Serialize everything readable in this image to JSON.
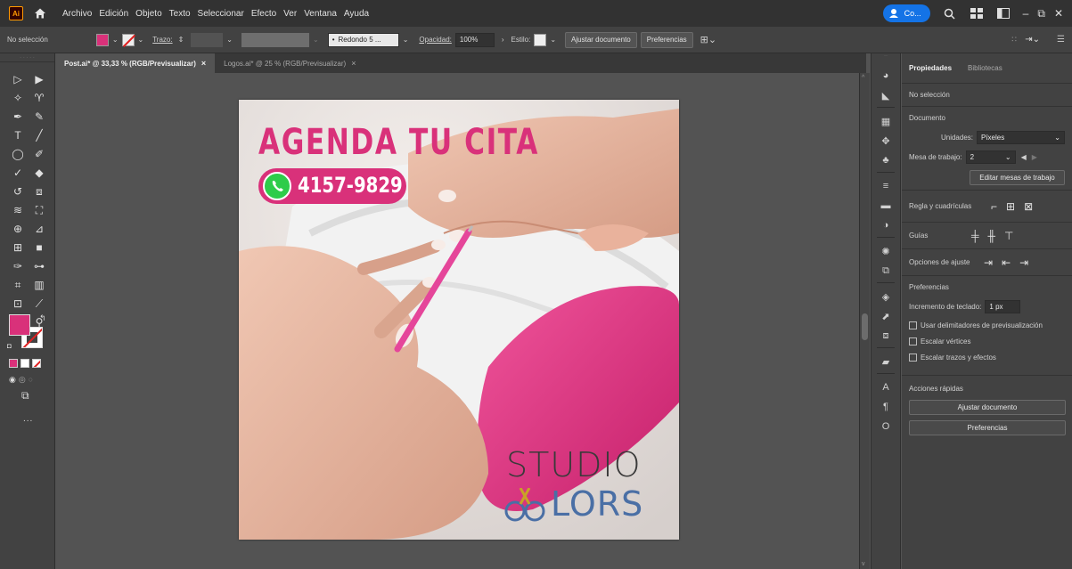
{
  "menubar": {
    "app_logo": "Ai",
    "items": [
      "Archivo",
      "Edición",
      "Objeto",
      "Texto",
      "Seleccionar",
      "Efecto",
      "Ver",
      "Ventana",
      "Ayuda"
    ],
    "cloud_label": "Co...",
    "home_icon": "home-icon",
    "search_icon": "search-icon"
  },
  "controlbar": {
    "selection": "No selección",
    "stroke_label": "Trazo:",
    "brush": "Redondo 5 ...",
    "opacity_label": "Opacidad:",
    "opacity_value": "100%",
    "style_label": "Estilo:",
    "fit_doc_button": "Ajustar documento",
    "prefs_button": "Preferencias",
    "fill_color": "#d9317a"
  },
  "tabs": [
    {
      "label": "Post.ai* @ 33,33 % (RGB/Previsualizar)",
      "close": "×"
    },
    {
      "label": "Logos.ai* @ 25 % (RGB/Previsualizar)",
      "close": "×"
    }
  ],
  "artboard": {
    "headline": "AGENDA TU CITA",
    "phone": "4157-9829",
    "brand_line1": "STUDIO",
    "brand_line2": "LORS",
    "accent": "#d9317a"
  },
  "properties": {
    "tab_active": "Propiedades",
    "tab_other": "Bibliotecas",
    "selection": "No selección",
    "document": "Documento",
    "units_label": "Unidades:",
    "units_value": "Píxeles",
    "artboard_label": "Mesa de trabajo:",
    "artboard_value": "2",
    "edit_artboards": "Editar mesas de trabajo",
    "rulers_grids": "Regla y cuadrículas",
    "guides": "Guías",
    "snap_options": "Opciones de ajuste",
    "preferences": "Preferencias",
    "keyboard_increment_label": "Incremento de teclado:",
    "keyboard_increment_value": "1 px",
    "chk_preview_bounds": "Usar delimitadores de previsualización",
    "chk_scale_corners": "Escalar vértices",
    "chk_scale_strokes": "Escalar trazos y efectos",
    "quick_actions": "Acciones rápidas",
    "fit_doc_button": "Ajustar documento",
    "prefs_button": "Preferencias"
  },
  "toolbar": {
    "more": "..."
  }
}
